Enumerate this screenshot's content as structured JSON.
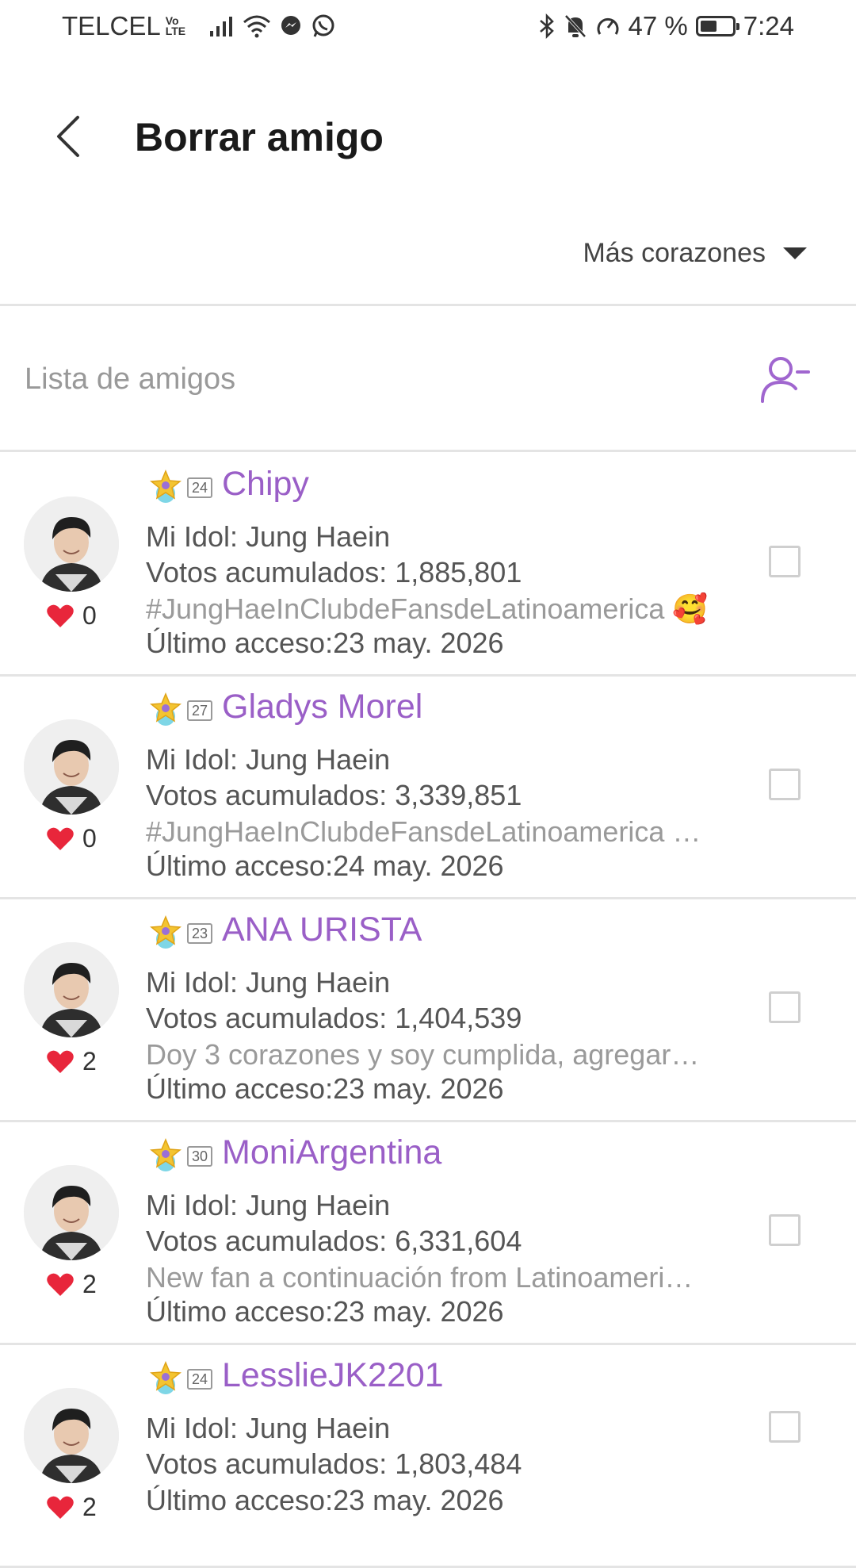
{
  "status": {
    "carrier": "TELCEL",
    "volte_top": "Vo",
    "volte_bottom": "LTE",
    "battery": "47 %",
    "time": "7:24",
    "battery_level": 0.47
  },
  "header": {
    "title": "Borrar amigo"
  },
  "sort": {
    "label": "Más corazones"
  },
  "list": {
    "label": "Lista de amigos"
  },
  "friends": [
    {
      "level": "24",
      "name": "Chipy",
      "hearts": "0",
      "idol": "Mi Idol: Jung Haein",
      "votes": "Votos acumulados: 1,885,801",
      "motto": "#JungHaeInClubdeFansdeLatinoamerica 🥰",
      "last": "Último acceso:23 may. 2026"
    },
    {
      "level": "27",
      "name": "Gladys Morel",
      "hearts": "0",
      "idol": "Mi Idol: Jung Haein",
      "votes": "Votos acumulados: 3,339,851",
      "motto": "#JungHaeInClubdeFansdeLatinoamerica …",
      "last": "Último acceso:24 may. 2026"
    },
    {
      "level": "23",
      "name": "ANA URISTA",
      "hearts": "2",
      "idol": "Mi Idol: Jung Haein",
      "votes": "Votos acumulados: 1,404,539",
      "motto": "Doy 3 corazones y soy cumplida, agregar…",
      "last": "Último acceso:23 may. 2026"
    },
    {
      "level": "30",
      "name": "MoniArgentina",
      "hearts": "2",
      "idol": "Mi Idol: Jung Haein",
      "votes": "Votos acumulados: 6,331,604",
      "motto": "New fan a continuación from Latinoameri…",
      "last": "Último acceso:23 may. 2026"
    },
    {
      "level": "24",
      "name": "LesslieJK2201",
      "hearts": "2",
      "idol": "Mi Idol: Jung Haein",
      "votes": "Votos acumulados: 1,803,484",
      "motto": "",
      "last": "Último acceso:23 may. 2026"
    }
  ],
  "colors": {
    "accent": "#9a5fc7",
    "heart": "#e8263b"
  }
}
